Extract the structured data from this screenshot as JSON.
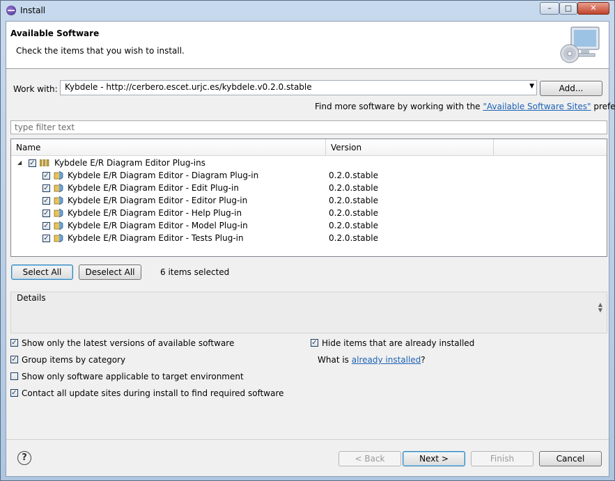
{
  "window": {
    "title": "Install",
    "min": "–",
    "max": "□",
    "close": "✕"
  },
  "header": {
    "title": "Available Software",
    "subtitle": "Check the items that you wish to install."
  },
  "work_with": {
    "label": "Work with:",
    "value": "Kybdele - http://cerbero.escet.urjc.es/kybdele.v0.2.0.stable",
    "add_button": "Add...",
    "find_more_prefix": "Find more software by working with the ",
    "find_more_link": "\"Available Software Sites\"",
    "find_more_suffix": " preferences."
  },
  "filter": {
    "placeholder": "type filter text"
  },
  "tree": {
    "columns": [
      "Name",
      "Version"
    ],
    "category": "Kybdele E/R Diagram Editor Plug-ins",
    "items": [
      {
        "name": "Kybdele E/R Diagram Editor - Diagram Plug-in",
        "version": "0.2.0.stable"
      },
      {
        "name": "Kybdele E/R Diagram Editor - Edit Plug-in",
        "version": "0.2.0.stable"
      },
      {
        "name": "Kybdele E/R Diagram Editor - Editor Plug-in",
        "version": "0.2.0.stable"
      },
      {
        "name": "Kybdele E/R Diagram Editor - Help Plug-in",
        "version": "0.2.0.stable"
      },
      {
        "name": "Kybdele E/R Diagram Editor - Model Plug-in",
        "version": "0.2.0.stable"
      },
      {
        "name": "Kybdele E/R Diagram Editor - Tests Plug-in",
        "version": "0.2.0.stable"
      }
    ]
  },
  "selection": {
    "select_all": "Select All",
    "deselect_all": "Deselect All",
    "count": "6 items selected"
  },
  "details": {
    "label": "Details"
  },
  "options": {
    "latest_versions": "Show only the latest versions of available software",
    "group_by_category": "Group items by category",
    "applicable_only": "Show only software applicable to target environment",
    "contact_sites": "Contact all update sites during install to find required software",
    "hide_installed": "Hide items that are already installed",
    "what_is_prefix": "What is ",
    "what_is_link": "already installed",
    "what_is_suffix": "?"
  },
  "buttons": {
    "help": "?",
    "back": "< Back",
    "next": "Next >",
    "finish": "Finish",
    "cancel": "Cancel"
  },
  "colors": {
    "link": "#1d62b5",
    "window_frame": "#aec6e0"
  }
}
